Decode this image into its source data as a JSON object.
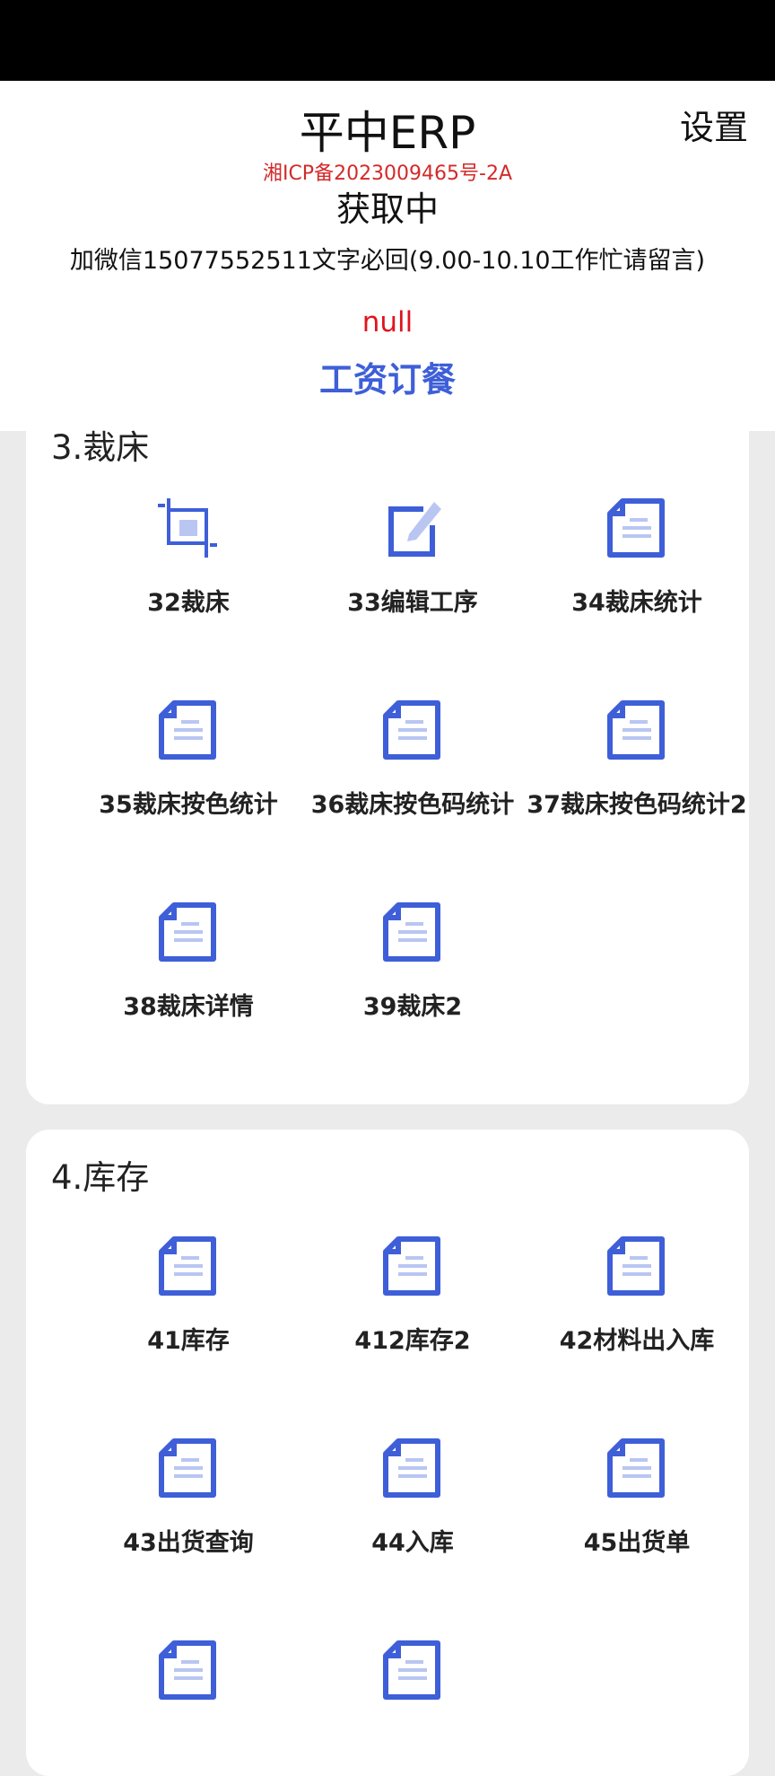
{
  "header": {
    "title": "平中ERP",
    "settings": "设置",
    "icp": "湘ICP备2023009465号-2A",
    "status": "获取中",
    "contact": "加微信15077552511文字必回(9.00-10.10工作忙请留言)",
    "null_value": "null",
    "tab": "工资订餐"
  },
  "sections": [
    {
      "title": "3.裁床",
      "items": [
        {
          "label": "32裁床",
          "icon": "crop-icon"
        },
        {
          "label": "33编辑工序",
          "icon": "edit-icon"
        },
        {
          "label": "34裁床统计",
          "icon": "document-icon"
        },
        {
          "label": "35裁床按色统计",
          "icon": "document-icon"
        },
        {
          "label": "36裁床按色码统计",
          "icon": "document-icon"
        },
        {
          "label": "37裁床按色码统计2",
          "icon": "document-icon"
        },
        {
          "label": "38裁床详情",
          "icon": "document-icon"
        },
        {
          "label": "39裁床2",
          "icon": "document-icon"
        }
      ]
    },
    {
      "title": "4.库存",
      "items": [
        {
          "label": "41库存",
          "icon": "document-icon"
        },
        {
          "label": "412库存2",
          "icon": "document-icon"
        },
        {
          "label": "42材料出入库",
          "icon": "document-icon"
        },
        {
          "label": "43出货查询",
          "icon": "document-icon"
        },
        {
          "label": "44入库",
          "icon": "document-icon"
        },
        {
          "label": "45出货单",
          "icon": "document-icon"
        },
        {
          "label": "",
          "icon": "document-icon"
        },
        {
          "label": "",
          "icon": "document-icon"
        }
      ]
    }
  ],
  "colors": {
    "accent": "#3e5fd8",
    "icon_light": "#b9c6f2",
    "icp_red": "#d42a2a",
    "null_red": "#e0141e"
  }
}
